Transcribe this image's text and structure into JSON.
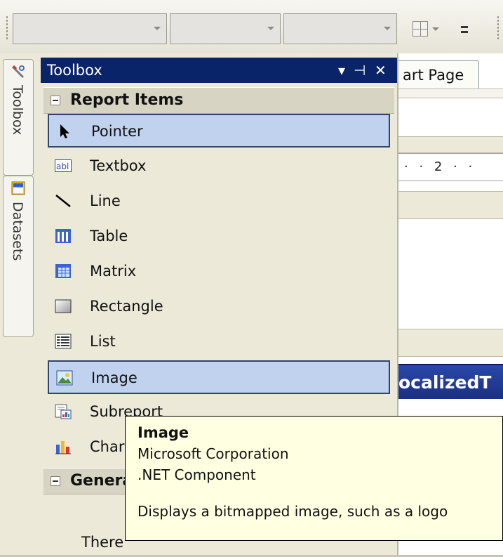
{
  "toolbox": {
    "title": "Toolbox",
    "controls": {
      "dropdown": "▾",
      "pin": "⊣",
      "close": "✕"
    },
    "sections": [
      {
        "label": "Report Items",
        "items": [
          {
            "label": "Pointer",
            "icon": "pointer-icon",
            "selected": true
          },
          {
            "label": "Textbox",
            "icon": "textbox-icon"
          },
          {
            "label": "Line",
            "icon": "line-icon"
          },
          {
            "label": "Table",
            "icon": "table-icon"
          },
          {
            "label": "Matrix",
            "icon": "matrix-icon"
          },
          {
            "label": "Rectangle",
            "icon": "rectangle-icon"
          },
          {
            "label": "List",
            "icon": "list-icon"
          },
          {
            "label": "Image",
            "icon": "image-icon",
            "selected": true
          },
          {
            "label": "Subreport",
            "icon": "subreport-icon"
          },
          {
            "label": "Chart",
            "icon": "chart-icon"
          }
        ]
      },
      {
        "label": "General"
      }
    ],
    "general_text": "There"
  },
  "side_tabs": [
    {
      "label": "Toolbox",
      "icon": "toolbox-icon"
    },
    {
      "label": "Datasets",
      "icon": "datasets-icon"
    }
  ],
  "document": {
    "tab_label": "art Page",
    "ruler_text": "· · 2 · ·",
    "localized_label": "ocalizedT"
  },
  "tooltip": {
    "title": "Image",
    "company": "Microsoft Corporation",
    "type": ".NET Component",
    "description": "Displays a bitmapped image, such as a logo"
  },
  "colors": {
    "title_bar": "#0a246a",
    "selection_fill": "#c1d2ee",
    "selection_border": "#31466e",
    "tooltip_bg": "#ffffe1"
  }
}
